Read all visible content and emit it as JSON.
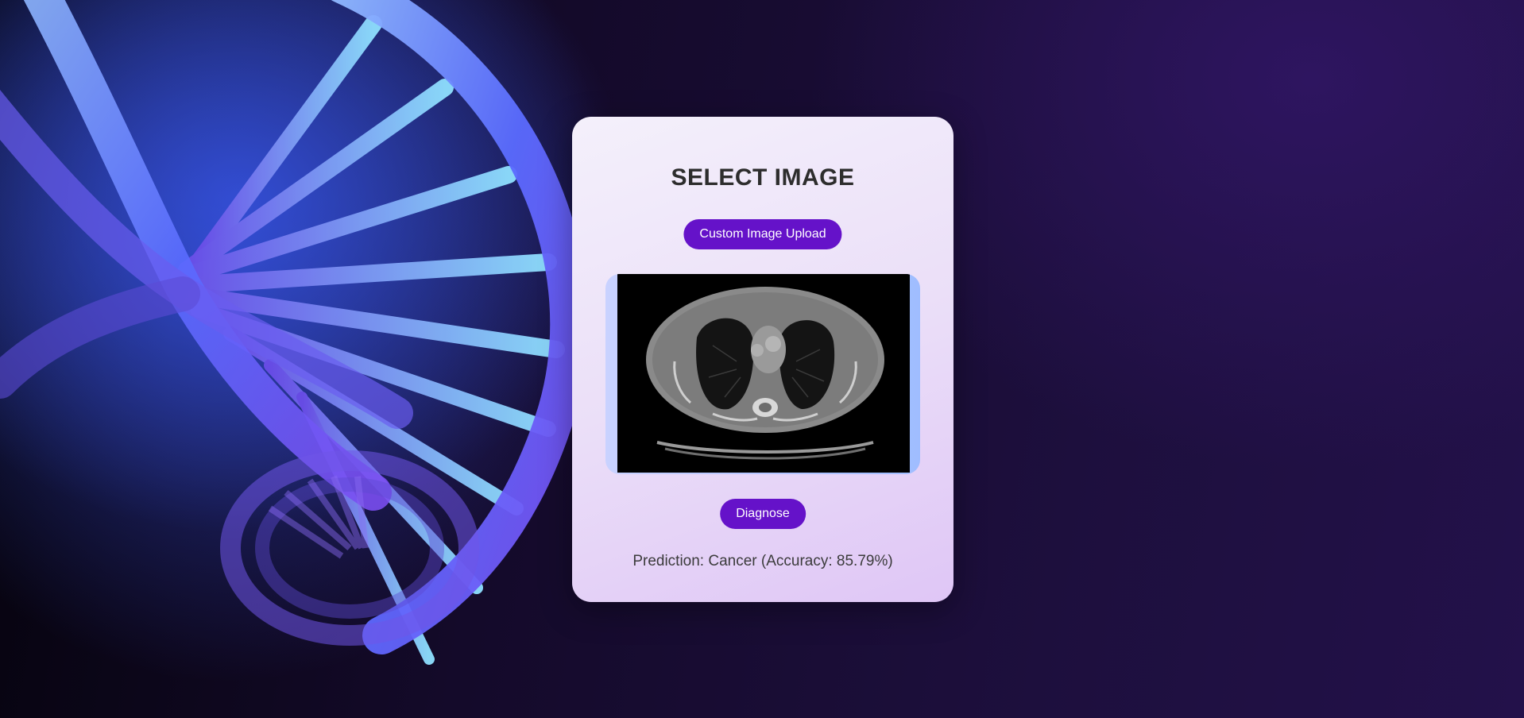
{
  "card": {
    "title": "SELECT IMAGE",
    "upload_label": "Custom Image Upload",
    "diagnose_label": "Diagnose",
    "prediction_text": "Prediction: Cancer (Accuracy: 85.79%)"
  },
  "colors": {
    "button": "#6512c9",
    "card_top": "#f4f0fb",
    "card_bottom": "#dfc6f6",
    "background_dark": "#140a2a",
    "dna_blue": "#5a6bff"
  },
  "images": {
    "background": "dna-helix-illustration",
    "preview": "chest-ct-scan"
  }
}
